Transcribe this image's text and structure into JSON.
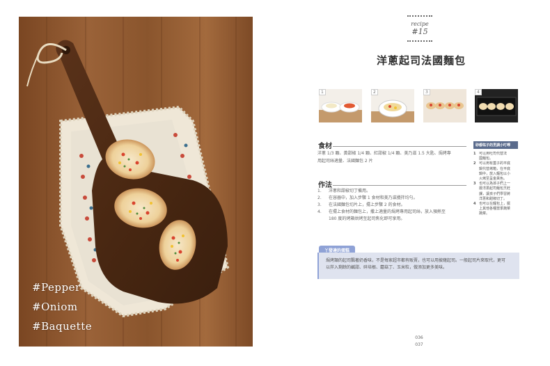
{
  "photo": {
    "hashtags": [
      "#Pepper",
      "#Oniom",
      "#Baquette"
    ]
  },
  "recipe": {
    "label": "recipe",
    "number": "#15",
    "title": "洋蔥起司法國麵包"
  },
  "step_images": [
    "1",
    "2",
    "3",
    "4"
  ],
  "ingredients": {
    "heading": "食材",
    "text_line1": "洋蔥 1/3 顆、黃甜椒 1/4 顆、紅甜椒 1/4 顆、美乃滋 1.5 大匙、焗烤專",
    "text_line2": "用起司絲適量、法國麵包 2 片"
  },
  "method": {
    "heading": "作法",
    "steps": [
      {
        "n": "1.",
        "text": "洋蔥和甜椒切丁備用。"
      },
      {
        "n": "2.",
        "text": "在容器中，加入步驟 1 食材和美乃滋攪拌均勻。"
      },
      {
        "n": "3.",
        "text": "在法國麵包切片上，擺上步驟 2 的食材。"
      },
      {
        "n": "4.",
        "text": "在擺上食材的麵包上，撒上適量的焗烤專用起司絲，放入預熱至"
      },
      {
        "n": "",
        "text": "180 度的烤箱烘烤至起司焦化即可享用。"
      }
    ]
  },
  "sidebar": {
    "heading": "砂都佑子的烹調小叮嚀",
    "items": [
      {
        "n": "1",
        "text": "可以用吐司代替法"
      },
      {
        "n": "",
        "text": "國麵包。"
      },
      {
        "n": "2",
        "text": "可以用有蓋子的平底"
      },
      {
        "n": "",
        "text": "鍋代替烤箱，在平底"
      },
      {
        "n": "",
        "text": "鍋中，放入麵包以小"
      },
      {
        "n": "",
        "text": "火烤至呈金黃色。"
      },
      {
        "n": "3",
        "text": "也可以為孩子們上一"
      },
      {
        "n": "",
        "text": "層洋蔥起司麵包烹飪"
      },
      {
        "n": "",
        "text": "課，讓孩子們學習將"
      },
      {
        "n": "",
        "text": "洋蔥和甜椒切丁。"
      },
      {
        "n": "4",
        "text": "也可以在麵包上，擺"
      },
      {
        "n": "",
        "text": "上其他各種當季蔬菜"
      },
      {
        "n": "",
        "text": "蔬菜。"
      }
    ]
  },
  "tip": {
    "tab": "丫發達的蛋糕",
    "line1": "焗烤類的起司飄著奶香味，不是每家超市都有販賣，也可以用披薩起司。一般起司片來取代，更可",
    "line2": "以拌入剩餘的鹹甜、碎培根、蘑菇丁、玉米粒，做添加更多美味。"
  },
  "page_numbers": [
    "036",
    "037"
  ]
}
